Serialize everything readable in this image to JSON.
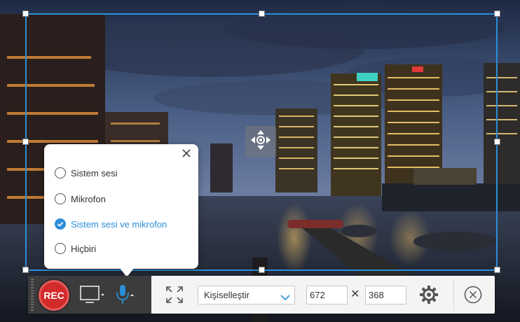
{
  "audio_popup": {
    "options": [
      {
        "label": "Sistem sesi",
        "selected": false
      },
      {
        "label": "Mikrofon",
        "selected": false
      },
      {
        "label": "Sistem sesi ve mikrofon",
        "selected": true
      },
      {
        "label": "Hiçbiri",
        "selected": false
      }
    ]
  },
  "toolbar": {
    "rec_label": "REC",
    "region_mode": "Kişiselleştir",
    "width": "672",
    "height": "368",
    "times_symbol": "✕"
  },
  "icons": {
    "close": "close-icon",
    "move": "move-icon",
    "display": "display-icon",
    "mic": "microphone-icon",
    "fullscreen": "fullscreen-icon",
    "settings": "gear-icon",
    "exit": "exit-icon",
    "check": "checkmark-icon"
  },
  "colors": {
    "accent": "#2b8fd8",
    "rec": "#d32a2a",
    "toolbar_dark": "#3c3c3c"
  }
}
